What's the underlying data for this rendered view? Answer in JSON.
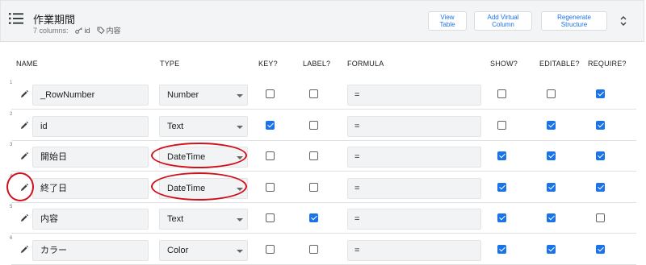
{
  "header": {
    "title": "作業期間",
    "columns_count": "7 columns:",
    "tag_key": "id",
    "tag_label": "内容",
    "buttons": {
      "view_table": "View Table",
      "add_virtual_column": "Add Virtual Column",
      "regenerate_structure": "Regenerate Structure"
    }
  },
  "columns": {
    "name": "NAME",
    "type": "TYPE",
    "key": "KEY?",
    "label": "LABEL?",
    "formula": "FORMULA",
    "show": "SHOW?",
    "editable": "EDITABLE?",
    "require": "REQUIRE?"
  },
  "rows": [
    {
      "num": "1",
      "name": "_RowNumber",
      "type": "Number",
      "key": false,
      "label": false,
      "formula": "=",
      "show": false,
      "editable": false,
      "require": true
    },
    {
      "num": "2",
      "name": "id",
      "type": "Text",
      "key": true,
      "label": false,
      "formula": "=",
      "show": false,
      "editable": true,
      "require": true
    },
    {
      "num": "3",
      "name": "開始日",
      "type": "DateTime",
      "key": false,
      "label": false,
      "formula": "=",
      "show": true,
      "editable": true,
      "require": true
    },
    {
      "num": "4",
      "name": "終了日",
      "type": "DateTime",
      "key": false,
      "label": false,
      "formula": "=",
      "show": true,
      "editable": true,
      "require": true
    },
    {
      "num": "5",
      "name": "内容",
      "type": "Text",
      "key": false,
      "label": true,
      "formula": "=",
      "show": true,
      "editable": true,
      "require": false
    },
    {
      "num": "6",
      "name": "カラー",
      "type": "Color",
      "key": false,
      "label": false,
      "formula": "=",
      "show": true,
      "editable": true,
      "require": true
    }
  ],
  "annotation_color": "#d0111b",
  "accent_color": "#1a73e8"
}
